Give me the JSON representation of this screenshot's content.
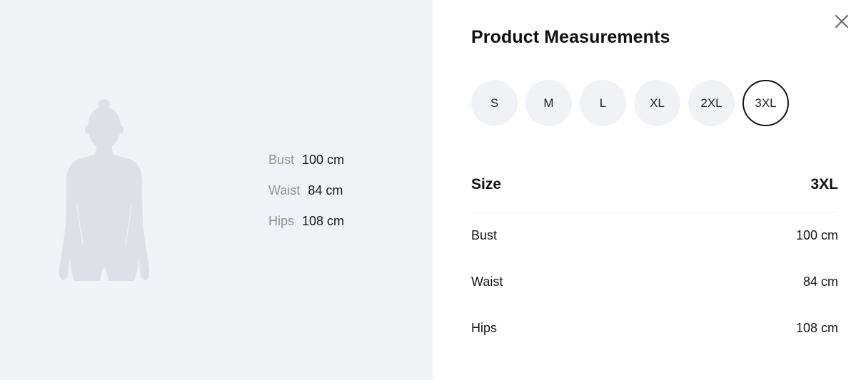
{
  "figure": {
    "measurements": [
      {
        "label": "Bust",
        "value": "100 cm"
      },
      {
        "label": "Waist",
        "value": "84 cm"
      },
      {
        "label": "Hips",
        "value": "108 cm"
      }
    ]
  },
  "panel": {
    "title": "Product Measurements",
    "close_icon": "close-icon",
    "sizes": [
      "S",
      "M",
      "L",
      "XL",
      "2XL",
      "3XL"
    ],
    "selected_size": "3XL",
    "table": {
      "header_label": "Size",
      "header_value": "3XL",
      "rows": [
        {
          "label": "Bust",
          "value": "100 cm"
        },
        {
          "label": "Waist",
          "value": "84 cm"
        },
        {
          "label": "Hips",
          "value": "108 cm"
        }
      ]
    }
  },
  "colors": {
    "left_bg": "#f1f2f6",
    "silhouette": "#dfe0e7",
    "muted_label": "#8f8f9e",
    "selected_border": "#111111"
  }
}
